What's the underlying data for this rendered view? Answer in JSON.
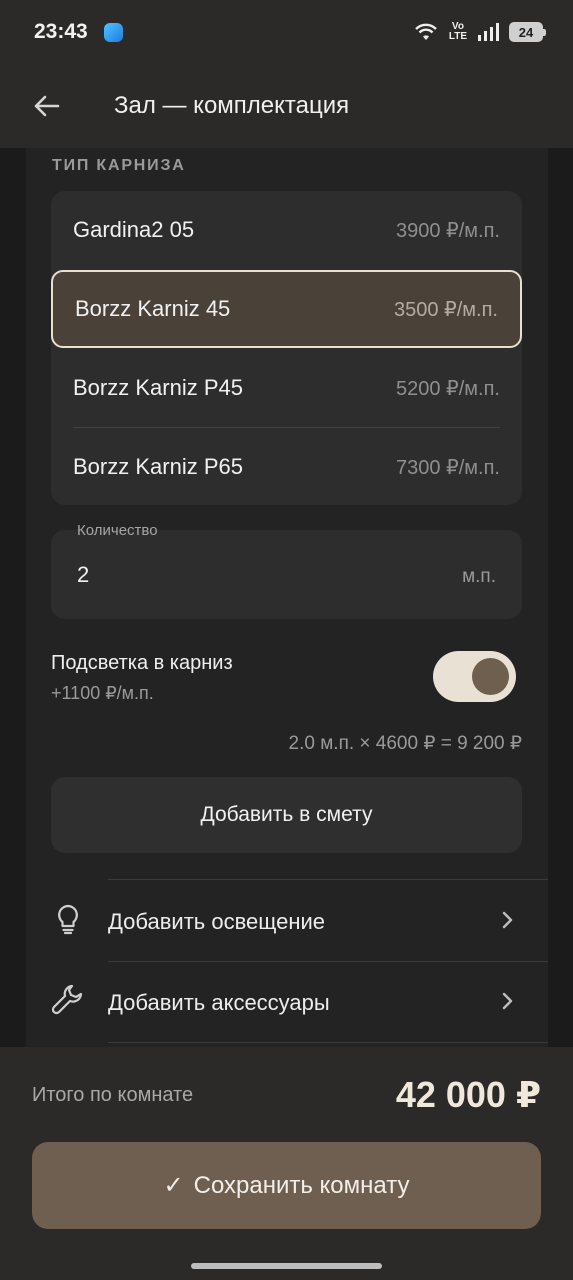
{
  "status_bar": {
    "time": "23:43",
    "network_label": "Vo\nLTE",
    "battery": "24",
    "icons": [
      "wifi-icon",
      "volte-icon",
      "signal-icon",
      "battery-icon"
    ]
  },
  "app_bar": {
    "title": "Зал — комплектация",
    "back_icon": "arrow-left-icon"
  },
  "cornice": {
    "section_label": "ТИП КАРНИЗА",
    "options": [
      {
        "name": "Gardina2 05",
        "price": "3900 ₽/м.п.",
        "selected": false
      },
      {
        "name": "Borzz Karniz 45",
        "price": "3500 ₽/м.п.",
        "selected": true
      },
      {
        "name": "Borzz Karniz P45",
        "price": "5200 ₽/м.п.",
        "selected": false
      },
      {
        "name": "Borzz Karniz P65",
        "price": "7300 ₽/м.п.",
        "selected": false
      }
    ]
  },
  "quantity": {
    "label": "Количество",
    "value": "2",
    "unit": "м.п."
  },
  "lighting": {
    "title": "Подсветка в карниз",
    "subtitle": "+1100 ₽/м.п.",
    "enabled": true,
    "calculation": "2.0 м.п. × 4600 ₽ = 9 200 ₽"
  },
  "add_to_estimate": "Добавить в смету",
  "actions": [
    {
      "label": "Добавить освещение",
      "icon": "lightbulb-icon"
    },
    {
      "label": "Добавить аксессуары",
      "icon": "wrench-icon"
    }
  ],
  "footer": {
    "total_label": "Итого по комнате",
    "total_value": "42 000 ₽",
    "save_check": "✓",
    "save_label": "Сохранить комнату"
  },
  "colors": {
    "accent": "#6f5f50",
    "selected_bg": "#4a4238",
    "toggle_track": "#e9e1d3"
  }
}
